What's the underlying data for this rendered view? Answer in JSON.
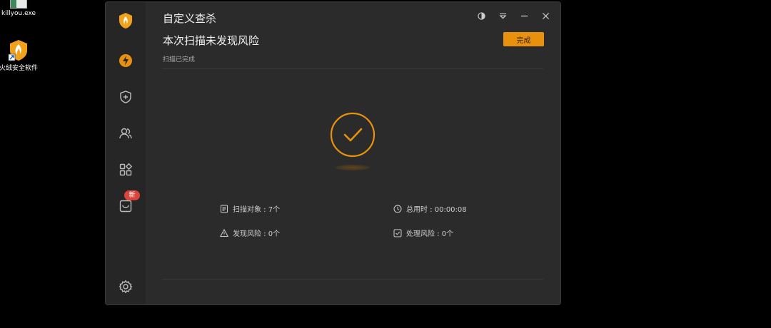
{
  "desktop": {
    "icons": [
      {
        "label": "killyou.exe",
        "icon": "exe-file-icon"
      },
      {
        "label": "火绒安全软件",
        "icon": "huorong-app-icon"
      }
    ]
  },
  "window": {
    "title": "自定义查杀",
    "controls": [
      "theme-toggle-icon",
      "menu-icon",
      "minimize-icon",
      "close-icon"
    ],
    "sidebar": {
      "items": [
        "logo-icon",
        "lightning-icon",
        "shield-plus-icon",
        "users-icon",
        "apps-icon",
        "toolbox-icon"
      ],
      "badge": "新",
      "settings": "gear-icon"
    },
    "headline": "本次扫描未发现风险",
    "status": "扫描已完成",
    "done_button": "完成",
    "stats": {
      "scan_objects": "扫描对象 : 7个",
      "total_time": "总用时 : 00:00:08",
      "risks_found": "发现风险 : 0个",
      "risks_handled": "处理风险 : 0个"
    },
    "accent": "#E8910E"
  }
}
